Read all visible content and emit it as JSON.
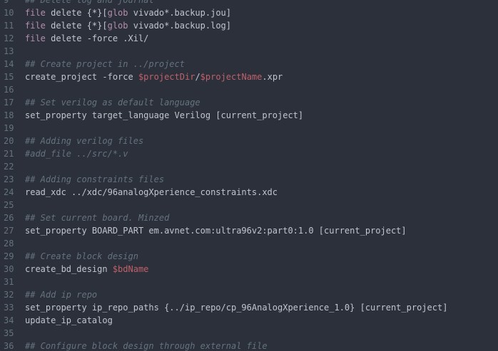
{
  "editor": {
    "lines": [
      {
        "num": "9",
        "tokens": [
          {
            "t": "comment",
            "v": "## Delete log and journal"
          }
        ]
      },
      {
        "num": "10",
        "tokens": [
          {
            "t": "kw",
            "v": "file"
          },
          {
            "t": "plain",
            "v": " delete {*}["
          },
          {
            "t": "kw",
            "v": "glob"
          },
          {
            "t": "plain",
            "v": " vivado*.backup.jou]"
          }
        ]
      },
      {
        "num": "11",
        "tokens": [
          {
            "t": "kw",
            "v": "file"
          },
          {
            "t": "plain",
            "v": " delete {*}["
          },
          {
            "t": "kw",
            "v": "glob"
          },
          {
            "t": "plain",
            "v": " vivado*.backup.log]"
          }
        ]
      },
      {
        "num": "12",
        "tokens": [
          {
            "t": "kw",
            "v": "file"
          },
          {
            "t": "plain",
            "v": " delete -force .Xil/"
          }
        ]
      },
      {
        "num": "13",
        "tokens": []
      },
      {
        "num": "14",
        "tokens": [
          {
            "t": "comment",
            "v": "## Create project in ../project"
          }
        ]
      },
      {
        "num": "15",
        "tokens": [
          {
            "t": "plain",
            "v": "create_project -force "
          },
          {
            "t": "var",
            "v": "$projectDir"
          },
          {
            "t": "plain",
            "v": "/"
          },
          {
            "t": "var",
            "v": "$projectName"
          },
          {
            "t": "plain",
            "v": ".xpr"
          }
        ]
      },
      {
        "num": "16",
        "tokens": []
      },
      {
        "num": "17",
        "tokens": [
          {
            "t": "comment",
            "v": "## Set verilog as default language"
          }
        ]
      },
      {
        "num": "18",
        "tokens": [
          {
            "t": "plain",
            "v": "set_property target_language Verilog [current_project]"
          }
        ]
      },
      {
        "num": "19",
        "tokens": []
      },
      {
        "num": "20",
        "tokens": [
          {
            "t": "comment",
            "v": "## Adding verilog files"
          }
        ]
      },
      {
        "num": "21",
        "tokens": [
          {
            "t": "comment",
            "v": "#add_file ../src/*.v"
          }
        ]
      },
      {
        "num": "22",
        "tokens": []
      },
      {
        "num": "23",
        "tokens": [
          {
            "t": "comment",
            "v": "## Adding constraints files"
          }
        ]
      },
      {
        "num": "24",
        "tokens": [
          {
            "t": "plain",
            "v": "read_xdc ../xdc/96analogXperience_constraints.xdc"
          }
        ]
      },
      {
        "num": "25",
        "tokens": []
      },
      {
        "num": "26",
        "tokens": [
          {
            "t": "comment",
            "v": "## Set current board. Minzed"
          }
        ]
      },
      {
        "num": "27",
        "tokens": [
          {
            "t": "plain",
            "v": "set_property BOARD_PART em.avnet.com:ultra96v2:part0:1.0 [current_project]"
          }
        ]
      },
      {
        "num": "28",
        "tokens": []
      },
      {
        "num": "29",
        "tokens": [
          {
            "t": "comment",
            "v": "## Create block design"
          }
        ]
      },
      {
        "num": "30",
        "tokens": [
          {
            "t": "plain",
            "v": "create_bd_design "
          },
          {
            "t": "var",
            "v": "$bdName"
          }
        ]
      },
      {
        "num": "31",
        "tokens": []
      },
      {
        "num": "32",
        "tokens": [
          {
            "t": "comment",
            "v": "## Add ip repo"
          }
        ]
      },
      {
        "num": "33",
        "tokens": [
          {
            "t": "plain",
            "v": "set_property ip_repo_paths {../ip_repo/cp_96AnalogXperience_1.0} [current_project]"
          }
        ]
      },
      {
        "num": "34",
        "tokens": [
          {
            "t": "plain",
            "v": "update_ip_catalog"
          }
        ]
      },
      {
        "num": "35",
        "tokens": []
      },
      {
        "num": "36",
        "tokens": [
          {
            "t": "comment",
            "v": "## Configure block design through external file"
          }
        ]
      }
    ]
  },
  "colors": {
    "background": "#2b303b",
    "gutter_text": "#65737e",
    "plain_text": "#c0c5ce",
    "keyword": "#b48ead",
    "variable": "#bf616a",
    "comment": "#65737e"
  }
}
